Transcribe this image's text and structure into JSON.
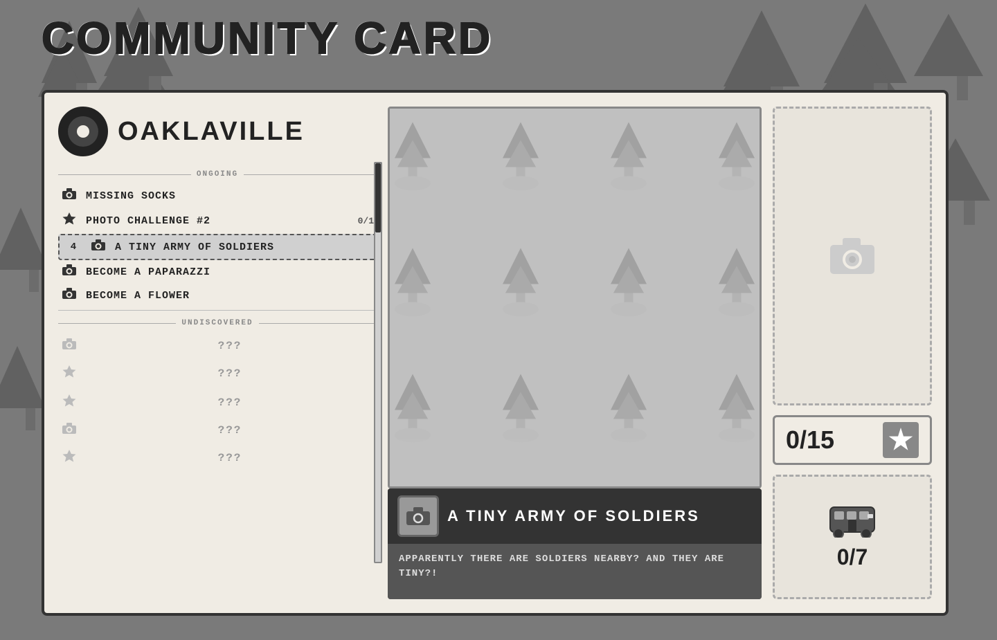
{
  "page": {
    "title": "COMMUNITY CARD",
    "background_color": "#6e6e6e"
  },
  "town": {
    "name": "OAKLAVILLE"
  },
  "ongoing_section": {
    "label": "ONGOING",
    "items": [
      {
        "id": "missing-socks",
        "icon": "camera",
        "label": "MISSING SOCKS",
        "badge": "",
        "active": false
      },
      {
        "id": "photo-challenge-2",
        "icon": "star",
        "label": "PHOTO CHALLENGE #2",
        "badge": "0/1",
        "active": false
      },
      {
        "id": "tiny-army",
        "icon": "camera",
        "label": "A TINY ARMY OF SOLDIERS",
        "badge": "",
        "num": "4",
        "active": true
      },
      {
        "id": "become-paparazzi",
        "icon": "camera",
        "label": "BECOME A PAPARAZZI",
        "badge": "",
        "active": false
      },
      {
        "id": "become-flower",
        "icon": "camera",
        "label": "BECOME A FLOWER",
        "badge": "",
        "active": false
      }
    ]
  },
  "undiscovered_section": {
    "label": "UNDISCOVERED",
    "items": [
      {
        "icon": "camera",
        "label": "???"
      },
      {
        "icon": "star",
        "label": "???"
      },
      {
        "icon": "star",
        "label": "???"
      },
      {
        "icon": "camera",
        "label": "???"
      },
      {
        "icon": "star",
        "label": "???"
      }
    ]
  },
  "selected_task": {
    "title": "A TINY ARMY OF SOLDIERS",
    "description": "APPARENTLY THERE ARE SOLDIERS NEARBY? AND THEY ARE TINY?!"
  },
  "stats": {
    "photo_score": "0/15",
    "bus_score": "0/7"
  },
  "photo_placeholder": {
    "aria": "photo upload area"
  }
}
